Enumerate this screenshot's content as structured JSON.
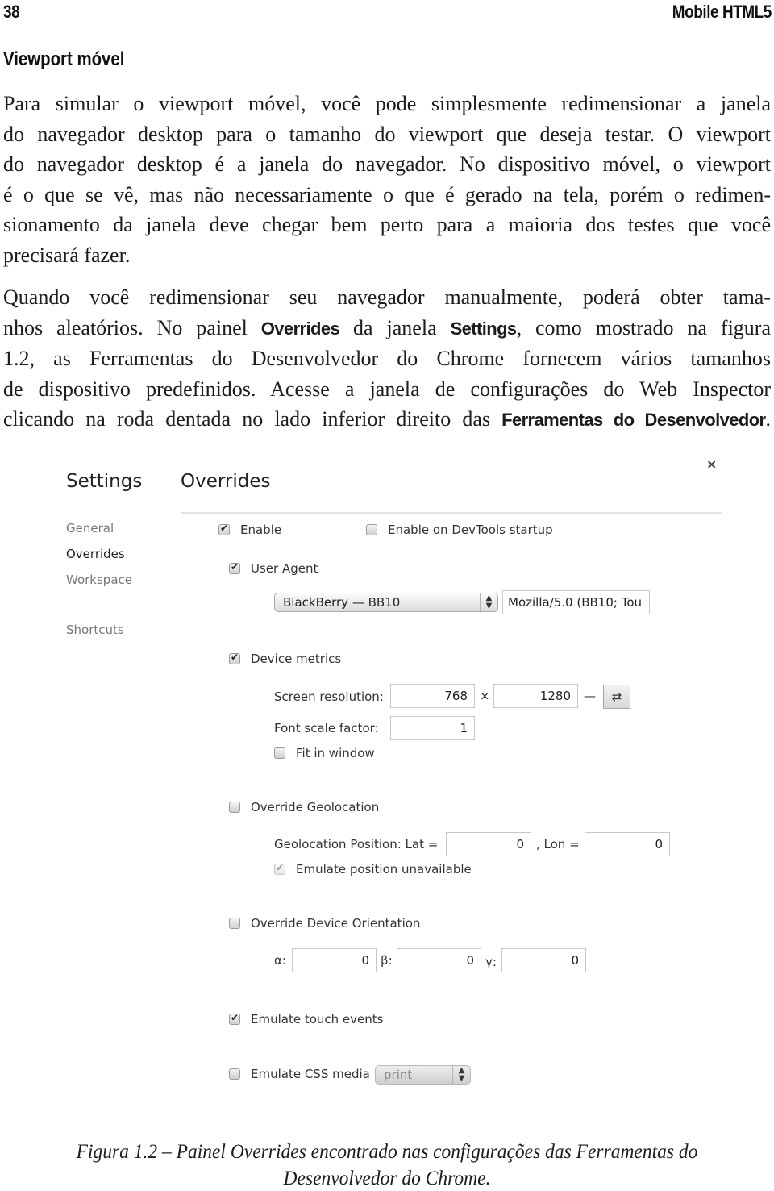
{
  "running_head": {
    "page_number": "38",
    "book_title": "Mobile HTML5"
  },
  "section": {
    "title": "Viewport móvel"
  },
  "paragraph1": {
    "lines": [
      "Para simular o viewport móvel, você pode simplesmente redimensionar a janela",
      "do navegador desktop para o tamanho do viewport que deseja testar. O viewport",
      "do navegador desktop é a janela do navegador. No dispositivo móvel, o viewport",
      "é o que se vê, mas não necessariamente o que é gerado na tela, porém o redimen-",
      "sionamento da janela deve chegar bem perto para a maioria dos testes que você",
      "precisará fazer."
    ]
  },
  "paragraph2": {
    "line1": "Quando você redimensionar seu navegador manualmente, poderá obter tama-",
    "line2_a": "nhos aleatórios. No painel ",
    "line2_b": "Overrides",
    "line2_c": " da janela ",
    "line2_d": "Settings",
    "line2_e": ", como mostrado na figura",
    "line3": "1.2, as Ferramentas do Desenvolvedor do Chrome fornecem vários tamanhos",
    "line4": "de dispositivo predefinidos. Acesse a janela de configurações do Web Inspector",
    "line5_a": "clicando na roda dentada no lado inferior direito das ",
    "line5_b": "Ferramentas do Desenvolvedor",
    "line5_c": "."
  },
  "settings_panel": {
    "title": "Settings",
    "close_icon": "×",
    "sidebar": {
      "items": [
        {
          "label": "General",
          "active": false
        },
        {
          "label": "Overrides",
          "active": true
        },
        {
          "label": "Workspace",
          "active": false
        },
        {
          "label": "Shortcuts",
          "active": false
        }
      ]
    },
    "overrides": {
      "title": "Overrides",
      "enable": {
        "label": "Enable",
        "checked": true
      },
      "enable_on_startup": {
        "label": "Enable on DevTools startup",
        "checked": false
      },
      "user_agent": {
        "label": "User Agent",
        "checked": true,
        "selected_device": "BlackBerry — BB10",
        "ua_string": "Mozilla/5.0 (BB10; Tou"
      },
      "device_metrics": {
        "label": "Device metrics",
        "checked": true,
        "screen_resolution_label": "Screen resolution:",
        "width": "768",
        "times": "×",
        "height": "1280",
        "dash": "—",
        "swap_icon": "⇄",
        "font_scale_label": "Font scale factor:",
        "font_scale": "1",
        "fit_in_window": {
          "label": "Fit in window",
          "checked": false
        }
      },
      "geolocation": {
        "label": "Override Geolocation",
        "checked": false,
        "position_label": "Geolocation Position: Lat =",
        "lat": "0",
        "lon_label": ", Lon =",
        "lon": "0",
        "emulate_unavailable": {
          "label": "Emulate position unavailable",
          "checked": true,
          "disabled": true
        }
      },
      "device_orientation": {
        "label": "Override Device Orientation",
        "checked": false,
        "alpha_label": "α:",
        "alpha": "0",
        "beta_label": "β:",
        "beta": "0",
        "gamma_label": "γ:",
        "gamma": "0"
      },
      "touch_events": {
        "label": "Emulate touch events",
        "checked": true
      },
      "css_media": {
        "label": "Emulate CSS media",
        "checked": false,
        "selected": "print"
      }
    }
  },
  "caption": {
    "line1": "Figura 1.2 – Painel Overrides encontrado nas configurações das Ferramentas do",
    "line2": "Desenvolvedor do Chrome."
  }
}
